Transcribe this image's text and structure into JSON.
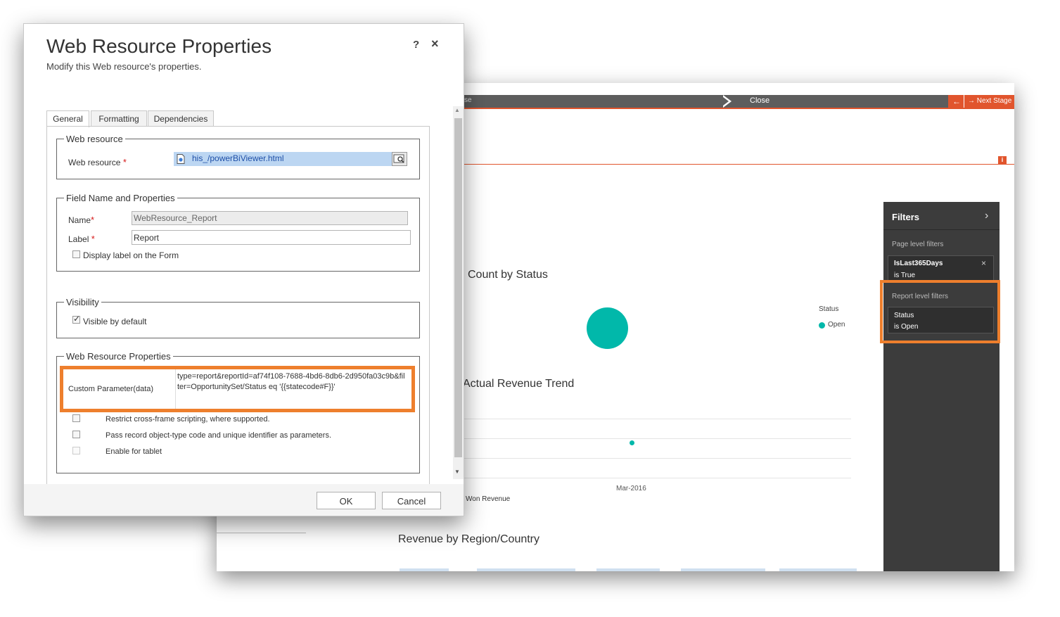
{
  "crm": {
    "stage_prev_fragment": "se",
    "stage_close": "Close",
    "back_arrow": "←",
    "next_stage": "→ Next Stage",
    "info_badge": "i",
    "charts": {
      "count_by_status": "Count by Status",
      "legend_title": "Status",
      "legend_item": "Open",
      "actual_revenue_trend": "Actual Revenue Trend",
      "x_tick": "Mar-2016",
      "series_label": "Won Revenue",
      "revenue_by_region": "Revenue by Region/Country"
    },
    "filters": {
      "title": "Filters",
      "chevron": "›",
      "page_level": "Page level filters",
      "card1_title": "IsLast365Days",
      "card1_sub": "is True",
      "card1_close": "×",
      "report_level": "Report level filters",
      "card2_title": "Status",
      "card2_sub": "is Open"
    }
  },
  "dialog": {
    "title": "Web Resource Properties",
    "subtitle": "Modify this Web resource's properties.",
    "help": "?",
    "close": "×",
    "tabs": [
      "General",
      "Formatting",
      "Dependencies"
    ],
    "web_resource_section": {
      "legend": "Web resource",
      "label": "Web resource",
      "required": "*",
      "value": "his_/powerBiViewer.html"
    },
    "field_section": {
      "legend": "Field Name and Properties",
      "name_label": "Name",
      "name_value": "WebResource_Report",
      "label_label": "Label",
      "label_value": "Report",
      "display_label": "Display label on the Form",
      "display_label_checked": false
    },
    "visibility_section": {
      "legend": "Visibility",
      "visible_label": "Visible by default",
      "visible_checked": true
    },
    "props_section": {
      "legend": "Web Resource Properties",
      "param_label": "Custom Parameter(data)",
      "param_value": "type=report&reportId=af74f108-7688-4bd6-8db6-2d950fa03c9b&filter=OpportunitySet/Status eq '{{statecode#F}}'",
      "restrict_label": "Restrict cross-frame scripting, where supported.",
      "pass_label": "Pass record object-type code and unique identifier as parameters.",
      "tablet_label": "Enable for tablet"
    },
    "ok": "OK",
    "cancel": "Cancel"
  }
}
